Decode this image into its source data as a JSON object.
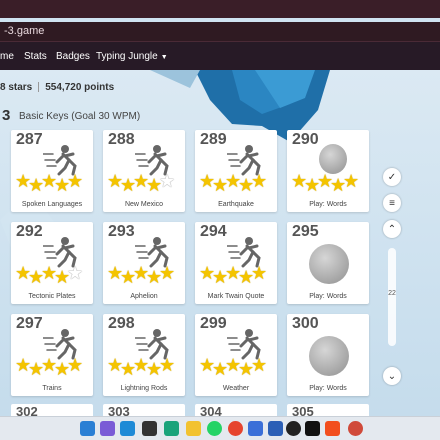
{
  "browser": {
    "address": "-3.game"
  },
  "nav": {
    "items": [
      "me",
      "Stats",
      "Badges",
      "Typing Jungle"
    ]
  },
  "stats": {
    "stars": "8 stars",
    "points": "554,720 points"
  },
  "level": {
    "number": "3",
    "title": "Basic Keys (Goal 30 WPM)"
  },
  "cards": [
    {
      "num": "287",
      "label": "Spoken Languages",
      "type": "runner",
      "stars": 5
    },
    {
      "num": "288",
      "label": "New Mexico",
      "type": "runner",
      "stars": 4
    },
    {
      "num": "289",
      "label": "Earthquake",
      "type": "runner",
      "stars": 5
    },
    {
      "num": "290",
      "label": "Play: Words",
      "type": "game",
      "stars": 5
    },
    {
      "num": "292",
      "label": "Tectonic Plates",
      "type": "runner",
      "stars": 4
    },
    {
      "num": "293",
      "label": "Aphelion",
      "type": "runner",
      "stars": 5
    },
    {
      "num": "294",
      "label": "Mark Twain Quote",
      "type": "runner",
      "stars": 5
    },
    {
      "num": "295",
      "label": "Play: Words",
      "type": "game",
      "stars": 0
    },
    {
      "num": "297",
      "label": "Trains",
      "type": "runner",
      "stars": 5
    },
    {
      "num": "298",
      "label": "Lightning Rods",
      "type": "runner",
      "stars": 5
    },
    {
      "num": "299",
      "label": "Weather",
      "type": "runner",
      "stars": 5
    },
    {
      "num": "300",
      "label": "Play: Words",
      "type": "game",
      "stars": 0
    }
  ],
  "peek": [
    "302",
    "303",
    "304",
    "305"
  ],
  "side": {
    "scroll_label": "22"
  },
  "colors": {
    "star": "#f4c400",
    "navbar": "#271a26",
    "addressbar": "#2f1a22"
  }
}
